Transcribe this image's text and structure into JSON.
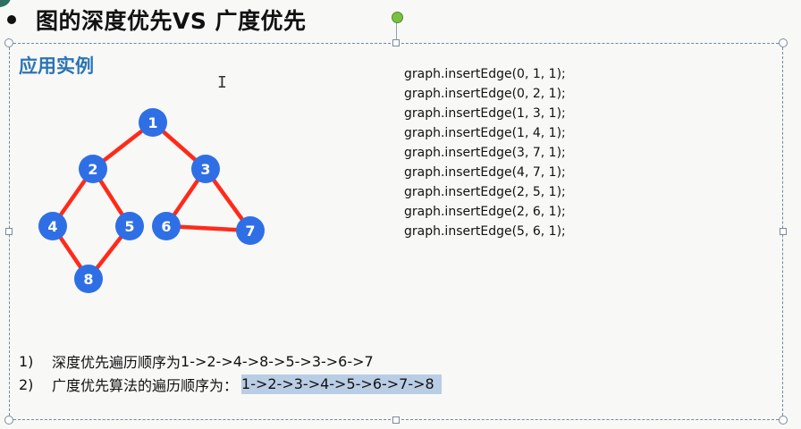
{
  "slide": {
    "title": "图的深度优先VS 广度优先",
    "section_title": "应用实例",
    "cursor_glyph": "I"
  },
  "code_lines": [
    "graph.insertEdge(0, 1, 1);",
    "graph.insertEdge(0, 2, 1);",
    "graph.insertEdge(1, 3, 1);",
    "graph.insertEdge(1, 4, 1);",
    "graph.insertEdge(3, 7, 1);",
    "graph.insertEdge(4, 7, 1);",
    "graph.insertEdge(2, 5, 1);",
    "graph.insertEdge(2, 6, 1);",
    "graph.insertEdge(5, 6, 1);"
  ],
  "graph": {
    "nodes": [
      "1",
      "2",
      "3",
      "4",
      "5",
      "6",
      "7",
      "8"
    ],
    "edges": [
      [
        "1",
        "2"
      ],
      [
        "1",
        "3"
      ],
      [
        "2",
        "4"
      ],
      [
        "2",
        "5"
      ],
      [
        "4",
        "8"
      ],
      [
        "5",
        "8"
      ],
      [
        "3",
        "6"
      ],
      [
        "3",
        "7"
      ],
      [
        "6",
        "7"
      ]
    ],
    "node_color": "#2f6fe6",
    "edge_color": "#ff2a1a"
  },
  "orders": [
    {
      "num": "1)",
      "label": "深度优先遍历顺序为",
      "sequence": "1->2->4->8->5->3->6->7"
    },
    {
      "num": "2)",
      "label": "广度优先算法的遍历顺序为：",
      "sequence": "1->2->3->4->5->6->7->8"
    }
  ]
}
